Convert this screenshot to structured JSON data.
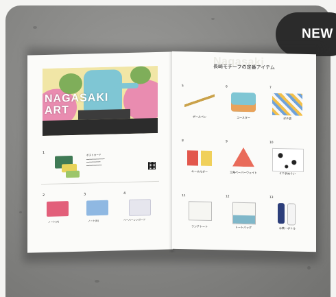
{
  "badge": {
    "label": "NEW"
  },
  "left_page": {
    "art_title_line1": "NAGASAKI",
    "art_title_line2": "ART",
    "items": [
      {
        "num": "1",
        "label": "ポストカード"
      },
      {
        "num": "2",
        "label": "ノート(A)"
      },
      {
        "num": "3",
        "label": "ノート(B)"
      },
      {
        "num": "4",
        "label": "ペーパーレンガード"
      }
    ]
  },
  "right_page": {
    "watermark": "Nagasaki",
    "title": "長崎モチーフの定番アイテム",
    "items": [
      {
        "num": "5",
        "label": "ボールペン"
      },
      {
        "num": "6",
        "label": "コースター"
      },
      {
        "num": "7",
        "label": "ポチ袋"
      },
      {
        "num": "8",
        "label": "キーホルダー"
      },
      {
        "num": "9",
        "label": "三角ペーパーウェイト"
      },
      {
        "num": "10",
        "label": "ミニ手ぬぐい"
      },
      {
        "num": "11",
        "label": "ランチトート"
      },
      {
        "num": "12",
        "label": "トートバッグ"
      },
      {
        "num": "13",
        "label": "水筒・ボトル"
      }
    ]
  },
  "colors": {
    "badge_bg": "#2b2b2b",
    "art_pink": "#e98cb0",
    "statue": "#7fc6d4"
  }
}
